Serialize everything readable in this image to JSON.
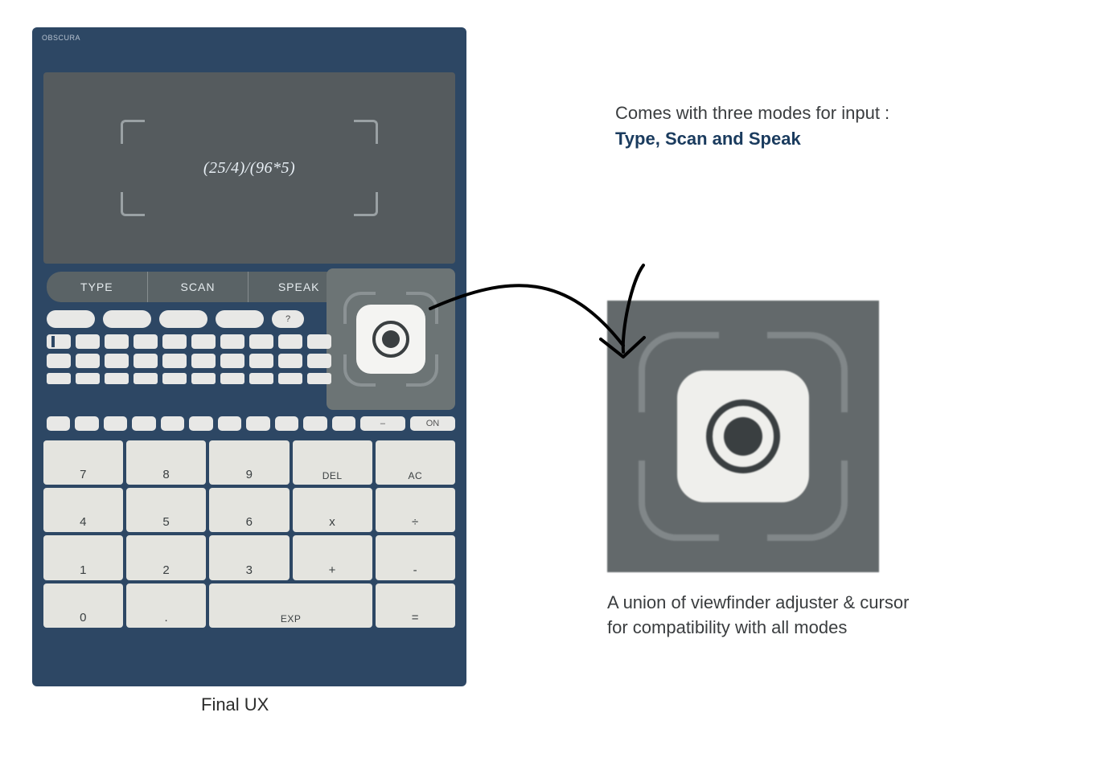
{
  "brand": "OBSCURA",
  "display_expression": "(25/4)/(96*5)",
  "modes": [
    "TYPE",
    "SCAN",
    "SPEAK"
  ],
  "funcRowA": [
    "",
    "",
    "",
    "",
    "?"
  ],
  "wideRow": {
    "dash": "–",
    "on": "ON"
  },
  "keypad": [
    [
      "7",
      "8",
      "9",
      "DEL",
      "AC"
    ],
    [
      "4",
      "5",
      "6",
      "x",
      "÷"
    ],
    [
      "1",
      "2",
      "3",
      "+",
      "-"
    ],
    [
      "0",
      ".",
      "EXP",
      "",
      "="
    ]
  ],
  "caption": "Final UX",
  "intro_line1": "Comes with three modes for input :",
  "intro_line2": "Type, Scan and Speak",
  "note_line1": "A union of viewfinder adjuster & cursor",
  "note_line2": "for compatibility with all modes"
}
